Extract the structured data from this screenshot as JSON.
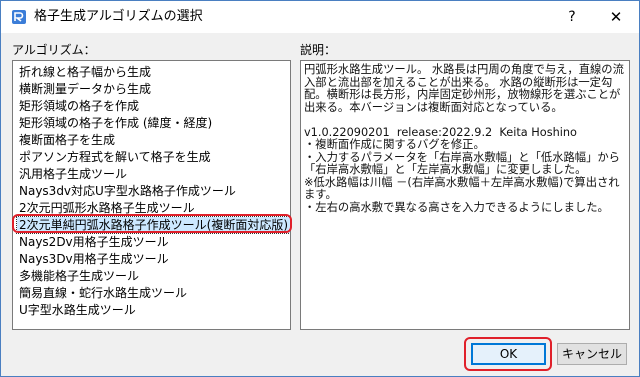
{
  "window": {
    "title": "格子生成アルゴリズムの選択",
    "help_glyph": "?",
    "close_glyph": "✕"
  },
  "algorithms": {
    "label": "アルゴリズム：",
    "items": [
      "折れ線と格子幅から生成",
      "横断測量データから生成",
      "矩形領域の格子を作成",
      "矩形領域の格子を作成 (緯度・経度)",
      "複断面格子を生成",
      "ポアソン方程式を解いて格子を生成",
      "汎用格子生成ツール",
      "Nays3dv対応U字型水路格子作成ツール",
      "2次元円弧形水路格子生成ツール",
      "2次元単純円弧水路格子作成ツール(複断面対応版)",
      "Nays2Dv用格子生成ツール",
      "Nays3Dv用格子生成ツール",
      "多機能格子生成ツール",
      "簡易直線・蛇行水路生成ツール",
      "U字型水路生成ツール"
    ],
    "selected_index": 9
  },
  "description": {
    "label": "説明：",
    "text": "円弧形水路生成ツール。 水路長は円周の角度で与え，直線の流入部と流出部を加えることが出来る。 水路の縦断形は一定勾配。横断形は長方形，内岸固定砂州形，放物線形を選ぶことが出来る。本バージョンは複断面対応となっている。\n\nv1.0.22090201  release:2022.9.2  Keita Hoshino\n・複断面作成に関するバグを修正。\n・入力するパラメータを「右岸高水敷幅」と「低水路幅」から「右岸高水敷幅」と「左岸高水敷幅」に変更しました。\n※低水路幅は川幅 －(右岸高水敷幅＋左岸高水敷幅)で算出されます。\n・左右の高水敷で異なる高さを入力できるようにしました。"
  },
  "buttons": {
    "ok": "OK",
    "cancel": "キャンセル"
  },
  "colors": {
    "highlight": "#e0202a",
    "selection": "#cce8ff",
    "accent": "#0078d7"
  }
}
